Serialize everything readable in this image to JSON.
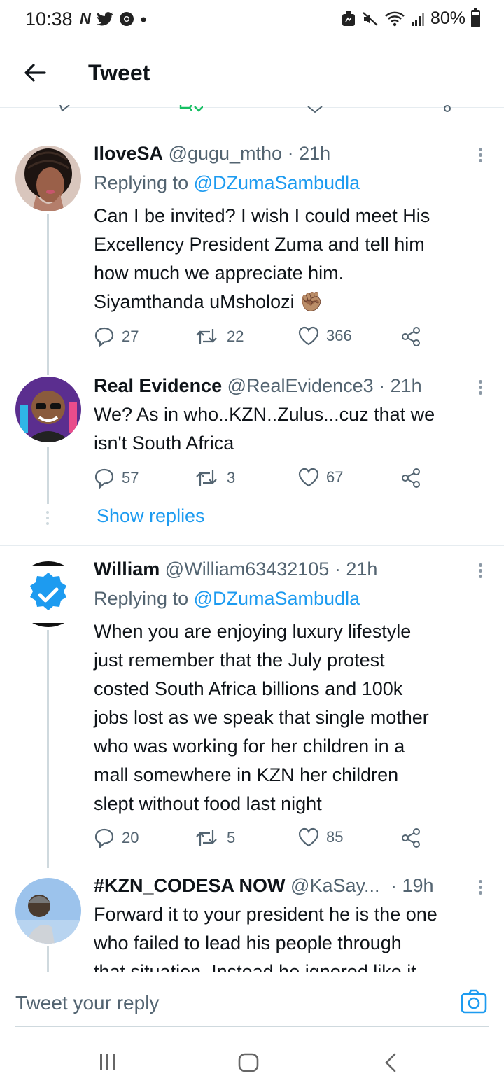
{
  "status_bar": {
    "time": "10:38",
    "notification_icons": [
      "N",
      "twitter-icon",
      "chrome-icon",
      "dot"
    ],
    "battery_text": "80%",
    "battery_level": 0.8
  },
  "header": {
    "title": "Tweet"
  },
  "tweets": [
    {
      "name": "IloveSA",
      "handle": "@gugu_mtho · 21h",
      "reply_prefix": "Replying to ",
      "reply_to": "@DZumaSambudla",
      "body": [
        "Can I be invited? I wish I could meet His",
        "Excellency President Zuma and tell him",
        "how much we appreciate him.",
        "Siyamthanda uMsholozi ✊🏽"
      ],
      "replies": "27",
      "retweets": "22",
      "likes": "366"
    },
    {
      "name": "Real Evidence",
      "handle": "@RealEvidence3 · 21h",
      "body": [
        "We? As in who..KZN..Zulus...cuz that we",
        "isn't South Africa"
      ],
      "replies": "57",
      "retweets": "3",
      "likes": "67",
      "show_replies": "Show replies"
    },
    {
      "name": "William",
      "handle": "@William63432105 · 21h",
      "reply_prefix": "Replying to ",
      "reply_to": "@DZumaSambudla",
      "body": [
        "When you are enjoying luxury lifestyle",
        "just remember that the July protest",
        "costed South Africa billions and 100k",
        "jobs lost as we speak that single mother",
        "who was working for her children in a",
        "mall somewhere in KZN her children",
        "slept without food last night"
      ],
      "replies": "20",
      "retweets": "5",
      "likes": "85"
    },
    {
      "name": "#KZN_CODESA NOW",
      "handle": "@KaSay...",
      "time": "· 19h",
      "body": [
        "Forward it to your president he is the one",
        "who failed to lead his people through",
        "that situation. Instead he ignored like it"
      ]
    }
  ],
  "reply_bar": {
    "placeholder": "Tweet your reply"
  },
  "colors": {
    "link": "#1d9bf0",
    "muted": "#536471",
    "text": "#0f1419"
  }
}
